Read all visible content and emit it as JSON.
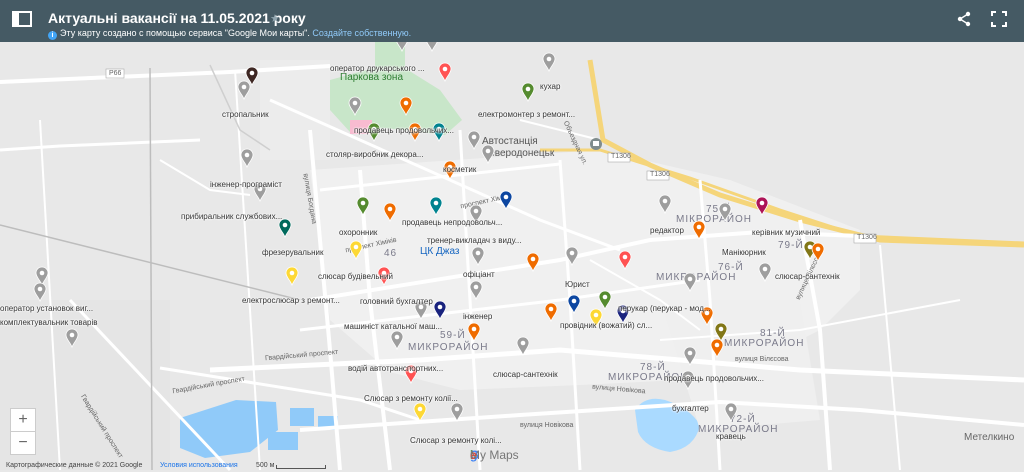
{
  "header": {
    "title": "Актуальні вакансії на 11.05.2021 року",
    "subtitle": "Эту карту создано с помощью сервиса \"Google Мои карты\".",
    "subtitle_link": "Создайте собственную."
  },
  "colors": {
    "header_bg": "#455a64",
    "grey": "#9e9e9e",
    "orange": "#ef6c00",
    "red": "#ff5252",
    "green": "#558b2f",
    "olive": "#827717",
    "teal": "#00838f",
    "darkteal": "#00695c",
    "blue": "#0d47a1",
    "navy": "#1a237e",
    "yellow": "#fdd835",
    "magenta": "#ad1457",
    "brown": "#3e2723"
  },
  "areas": [
    "Паркова зона",
    "Автостанція",
    "Северодонецьк",
    "75-Й",
    "МІКРОРАЙОН",
    "79-Й",
    "76-Й",
    "МИКРОРАЙОН",
    "59-Й",
    "МИКРОРАЙОН",
    "81-Й",
    "МИКРОРАЙОН",
    "78-Й",
    "МИКРОРАЙОН",
    "72-Й",
    "МИКРОРАЙОН",
    "ЦК Джаз",
    "46",
    "Метелкино"
  ],
  "streets": [
    "P66",
    "T1306",
    "T1306",
    "T1306",
    "Объездная ул.",
    "проспект Хіміків",
    "проспект Хіміків",
    "Гвардійський проспект",
    "Гвардійський проспект",
    "Гвардійський проспект",
    "вулиця Новікова",
    "вулиця Новікова",
    "вулиця Вілєсова",
    "вулиця Вілєсова",
    "вулиця Богдана",
    "Картографические данные © 2021 Google",
    "Условия использования",
    "500 м"
  ],
  "pins": [
    {
      "label": "оператор друкарського ...",
      "color": "grey"
    },
    {
      "label": "",
      "color": "red"
    },
    {
      "label": "кухар",
      "color": "grey"
    },
    {
      "label": "",
      "color": "grey"
    },
    {
      "label": "стропальник",
      "color": "grey"
    },
    {
      "label": "",
      "color": "brown"
    },
    {
      "label": "електромонтер з ремонт...",
      "color": "green"
    },
    {
      "label": "продавець продовольчих...",
      "color": "grey"
    },
    {
      "label": "",
      "color": "orange"
    },
    {
      "label": "столяр-виробник декора...",
      "color": "green"
    },
    {
      "label": "",
      "color": "orange"
    },
    {
      "label": "",
      "color": "teal"
    },
    {
      "label": "косметик",
      "color": "grey"
    },
    {
      "label": "",
      "color": "grey"
    },
    {
      "label": "",
      "color": "orange"
    },
    {
      "label": "інженер-програміст",
      "color": "grey"
    },
    {
      "label": "прибиральник службових...",
      "color": "grey"
    },
    {
      "label": "охоронник",
      "color": "green"
    },
    {
      "label": "продавець непродовольч...",
      "color": "teal"
    },
    {
      "label": "",
      "color": "blue"
    },
    {
      "label": "",
      "color": "orange"
    },
    {
      "label": "тренер-викладач з виду...",
      "color": "grey"
    },
    {
      "label": "фрезерувальник",
      "color": "darkteal"
    },
    {
      "label": "слюсар будівельний",
      "color": "yellow"
    },
    {
      "label": "офіціант",
      "color": "grey"
    },
    {
      "label": "",
      "color": "orange"
    },
    {
      "label": "Юрист",
      "color": "grey"
    },
    {
      "label": "",
      "color": "red"
    },
    {
      "label": "електрослюсар з ремонт...",
      "color": "yellow"
    },
    {
      "label": "головний бухгалтер",
      "color": "red"
    },
    {
      "label": "інженер",
      "color": "grey"
    },
    {
      "label": "машиніст катальної маш...",
      "color": "grey"
    },
    {
      "label": "",
      "color": "navy"
    },
    {
      "label": "провідник (вожатий) сл...",
      "color": "blue"
    },
    {
      "label": "",
      "color": "orange"
    },
    {
      "label": "",
      "color": "green"
    },
    {
      "label": "",
      "color": "yellow"
    },
    {
      "label": "",
      "color": "navy"
    },
    {
      "label": "водій автотранспортних...",
      "color": "grey"
    },
    {
      "label": "слюсар-сантехнік",
      "color": "grey"
    },
    {
      "label": "",
      "color": "orange"
    },
    {
      "label": "Слюсар з ремонту колії...",
      "color": "red"
    },
    {
      "label": "Слюсар з ремонту колі...",
      "color": "yellow"
    },
    {
      "label": "",
      "color": "grey"
    },
    {
      "label": "редактор",
      "color": "grey"
    },
    {
      "label": "керівник музичний",
      "color": "magenta"
    },
    {
      "label": "",
      "color": "orange"
    },
    {
      "label": "Манікюрник",
      "color": "grey"
    },
    {
      "label": "слюсар-сантехнік",
      "color": "olive"
    },
    {
      "label": "",
      "color": "orange"
    },
    {
      "label": "перукар (перукар - мод...",
      "color": "grey"
    },
    {
      "label": "",
      "color": "orange"
    },
    {
      "label": "",
      "color": "olive"
    },
    {
      "label": "продавець продовольчих...",
      "color": "grey"
    },
    {
      "label": "",
      "color": "orange"
    },
    {
      "label": "бухгалтер",
      "color": "grey"
    },
    {
      "label": "кравець",
      "color": "grey"
    },
    {
      "label": "оператор установок виг...",
      "color": "grey"
    },
    {
      "label": "комплектувальник товарів",
      "color": "grey"
    },
    {
      "label": "",
      "color": "grey"
    },
    {
      "label": "",
      "color": "grey"
    }
  ]
}
